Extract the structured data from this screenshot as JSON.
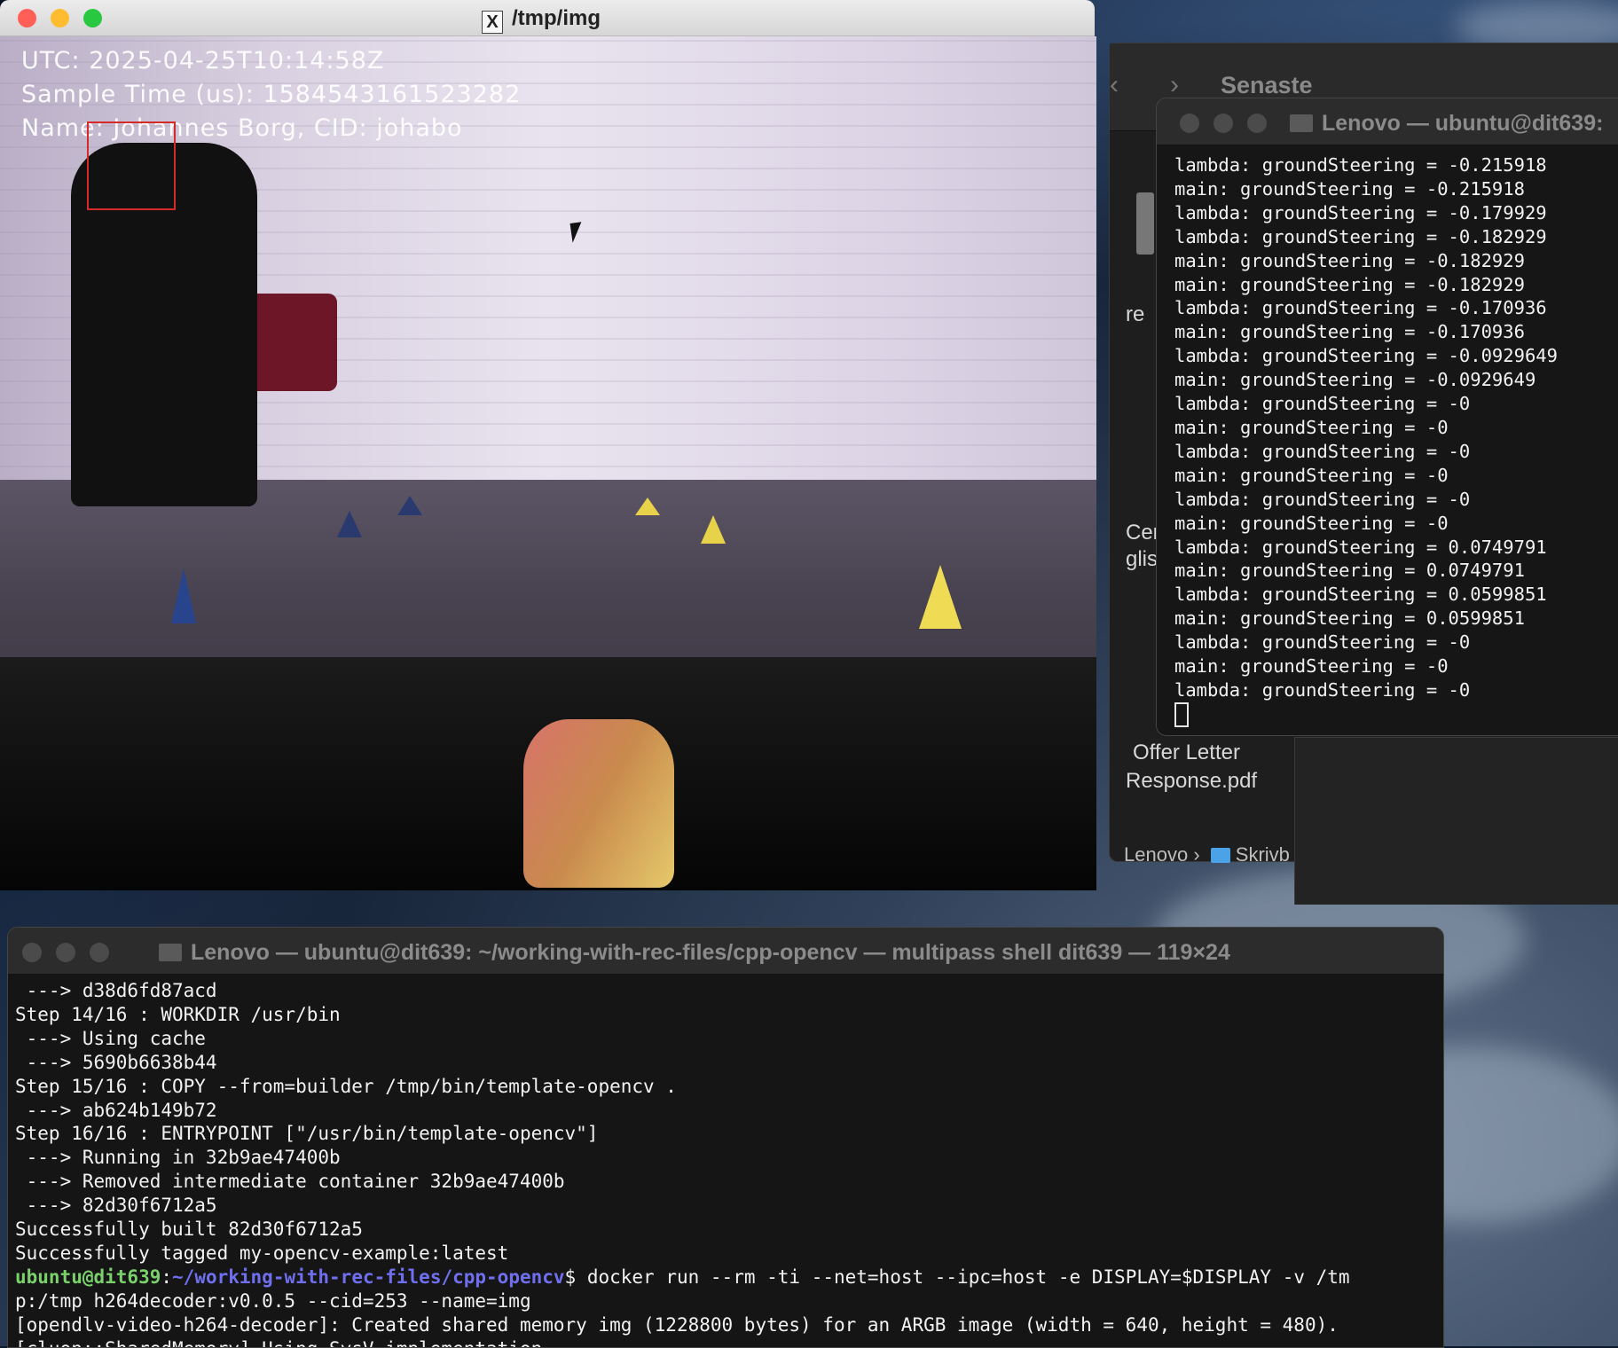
{
  "image_window": {
    "title": "/tmp/img",
    "overlay": {
      "utc": "UTC: 2025-04-25T10:14:58Z",
      "sample_time": "Sample Time (us): 1584543161523282",
      "name": "Name: Johannes Borg, CID: johabo"
    }
  },
  "finder": {
    "title": "Senaste",
    "side_texts": [
      "Cer",
      "glis",
      "re"
    ],
    "file_name_line1": "Offer Letter",
    "file_name_line2": "Response.pdf",
    "path_parent": "Lenovo",
    "path_separator": "›",
    "path_folder": "Skrivb"
  },
  "right_terminal": {
    "title": "Lenovo — ubuntu@dit639:",
    "lines": [
      "lambda: groundSteering = -0.215918",
      "main: groundSteering = -0.215918",
      "lambda: groundSteering = -0.179929",
      "lambda: groundSteering = -0.182929",
      "main: groundSteering = -0.182929",
      "main: groundSteering = -0.182929",
      "lambda: groundSteering = -0.170936",
      "main: groundSteering = -0.170936",
      "lambda: groundSteering = -0.0929649",
      "main: groundSteering = -0.0929649",
      "lambda: groundSteering = -0",
      "main: groundSteering = -0",
      "lambda: groundSteering = -0",
      "main: groundSteering = -0",
      "lambda: groundSteering = -0",
      "main: groundSteering = -0",
      "lambda: groundSteering = 0.0749791",
      "main: groundSteering = 0.0749791",
      "lambda: groundSteering = 0.0599851",
      "main: groundSteering = 0.0599851",
      "lambda: groundSteering = -0",
      "main: groundSteering = -0",
      "lambda: groundSteering = -0"
    ]
  },
  "bottom_terminal": {
    "title": "Lenovo — ubuntu@dit639: ~/working-with-rec-files/cpp-opencv — multipass shell dit639 — 119×24",
    "lines_before_prompt": [
      " ---> d38d6fd87acd",
      "Step 14/16 : WORKDIR /usr/bin",
      " ---> Using cache",
      " ---> 5690b6638b44",
      "Step 15/16 : COPY --from=builder /tmp/bin/template-opencv .",
      " ---> ab624b149b72",
      "Step 16/16 : ENTRYPOINT [\"/usr/bin/template-opencv\"]",
      " ---> Running in 32b9ae47400b",
      " ---> Removed intermediate container 32b9ae47400b",
      " ---> 82d30f6712a5",
      "Successfully built 82d30f6712a5",
      "Successfully tagged my-opencv-example:latest"
    ],
    "prompt_user": "ubuntu@dit639",
    "prompt_colon": ":",
    "prompt_path": "~/working-with-rec-files/cpp-opencv",
    "prompt_command": "$ docker run --rm -ti --net=host --ipc=host -e DISPLAY=$DISPLAY -v /tm",
    "lines_after_prompt": [
      "p:/tmp h264decoder:v0.0.5 --cid=253 --name=img",
      "[opendlv-video-h264-decoder]: Created shared memory img (1228800 bytes) for an ARGB image (width = 640, height = 480).",
      "[cluon::SharedMemory] Using SysV implementation."
    ]
  },
  "colors": {
    "close": "#ff5f57",
    "minimize": "#febc2e",
    "zoom": "#28c840",
    "prompt_user": "#7ad06b",
    "prompt_path": "#6f6ff0"
  }
}
